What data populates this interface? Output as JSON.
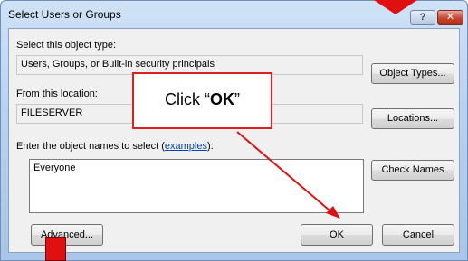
{
  "window": {
    "title": "Select Users or Groups",
    "help_label": "?",
    "close_label": "✕"
  },
  "object_type": {
    "label": "Select this object type:",
    "value": "Users, Groups, or Built-in security principals",
    "button": "Object Types..."
  },
  "location": {
    "label": "From this location:",
    "value": "FILESERVER",
    "button": "Locations..."
  },
  "names": {
    "label_prefix": "Enter the object names to select (",
    "label_link": "examples",
    "label_suffix": "):",
    "value": "Everyone",
    "check_button": "Check Names"
  },
  "footer": {
    "advanced_button": "Advanced...",
    "ok_button": "OK",
    "cancel_button": "Cancel"
  },
  "annotation": {
    "callout_prefix": "Click “",
    "callout_bold": "OK",
    "callout_suffix": "”",
    "color": "#e01010"
  }
}
